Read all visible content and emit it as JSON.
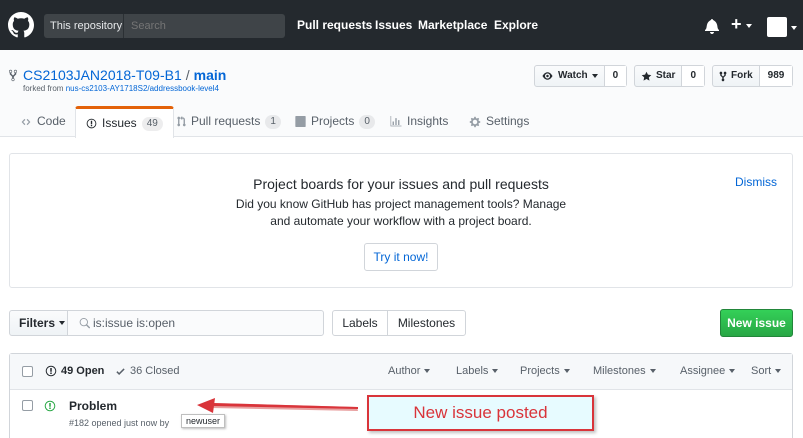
{
  "header": {
    "scope_label": "This repository",
    "search_placeholder": "Search",
    "nav": [
      "Pull requests",
      "Issues",
      "Marketplace",
      "Explore"
    ],
    "plus": "+"
  },
  "repo": {
    "owner": "CS2103JAN2018-T09-B1",
    "separator": "/",
    "name": "main",
    "forked_from_prefix": "forked from",
    "forked_from_link": "nus-cs2103-AY1718S2/addressbook-level4",
    "watch_label": "Watch",
    "watch_count": "0",
    "star_label": "Star",
    "star_count": "0",
    "fork_label": "Fork",
    "fork_count": "989"
  },
  "tabs": {
    "code": "Code",
    "issues": "Issues",
    "issues_count": "49",
    "pulls": "Pull requests",
    "pulls_count": "1",
    "projects": "Projects",
    "projects_count": "0",
    "insights": "Insights",
    "settings": "Settings"
  },
  "promo": {
    "title": "Project boards for your issues and pull requests",
    "text": "Did you know GitHub has project management tools? Manage and automate your workflow with a project board.",
    "dismiss": "Dismiss",
    "button": "Try it now!"
  },
  "subnav": {
    "filters": "Filters",
    "query": "is:issue is:open",
    "labels": "Labels",
    "milestones": "Milestones",
    "new_issue": "New issue"
  },
  "issues": {
    "open_label": "49 Open",
    "closed_label": "36 Closed",
    "filters": [
      "Author",
      "Labels",
      "Projects",
      "Milestones",
      "Assignee",
      "Sort"
    ],
    "rows": [
      {
        "title": "Problem",
        "meta": "#182 opened just now by",
        "author": "newuser"
      }
    ]
  },
  "annotation": {
    "text": "New issue posted"
  },
  "colors": {
    "header_bg": "#24292e",
    "link": "#0366d6",
    "open_green": "#28a745",
    "tab_accent": "#e36209",
    "annotation_red": "#d9343a",
    "annotation_bg": "#e7fbff"
  }
}
